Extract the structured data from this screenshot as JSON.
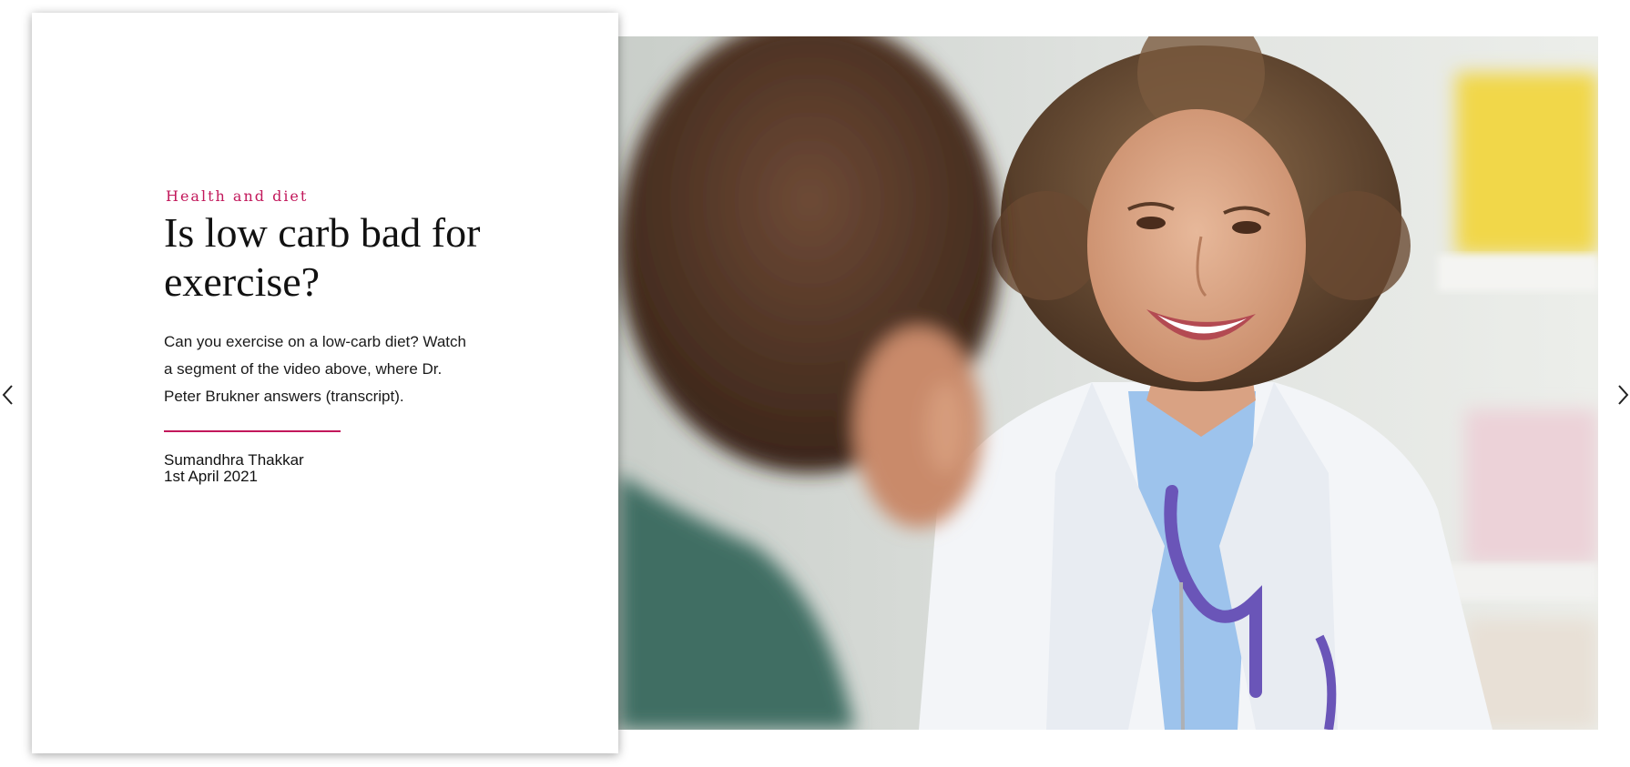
{
  "article": {
    "category": "Health and diet",
    "title_line1": "Is low carb bad for",
    "title_line2": "exercise?",
    "summary_line1": "Can you exercise on a low-carb diet? Watch",
    "summary_line2": "a segment of the video above, where Dr.",
    "summary_line3": "Peter Brukner answers (transcript).",
    "author": "Sumandhra Thakkar",
    "date": "1st April 2021"
  },
  "navigation": {
    "prev_icon": "chevron-left-icon",
    "next_icon": "chevron-right-icon"
  },
  "image": {
    "subject": "doctor-consultation-photo"
  },
  "colors": {
    "accent": "#c2185b",
    "text": "#111111",
    "background": "#ffffff"
  }
}
